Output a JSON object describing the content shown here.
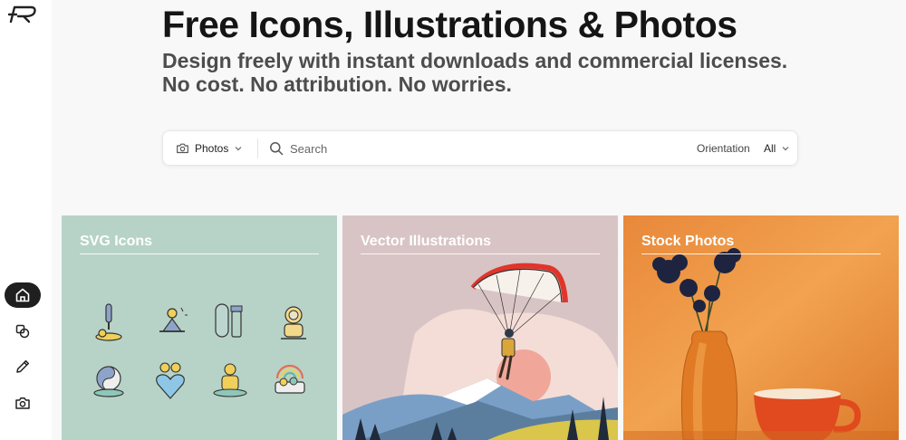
{
  "hero": {
    "title": "Free Icons, Illustrations & Photos",
    "subtitle_line1": "Design freely with instant downloads and commercial licenses.",
    "subtitle_line2": "No cost. No attribution. No worries."
  },
  "search": {
    "type_value": "Photos",
    "placeholder": "Search",
    "orientation_label": "Orientation",
    "orientation_value": "All"
  },
  "sidebar": {
    "items": [
      {
        "name": "home",
        "icon": "home-icon",
        "active": true
      },
      {
        "name": "shapes",
        "icon": "shapes-icon",
        "active": false
      },
      {
        "name": "pencil",
        "icon": "pencil-icon",
        "active": false
      },
      {
        "name": "camera",
        "icon": "camera-icon",
        "active": false
      }
    ]
  },
  "cards": [
    {
      "title": "SVG Icons",
      "bg": "#b7d3c7"
    },
    {
      "title": "Vector Illustrations",
      "bg": "#d9c4c5"
    },
    {
      "title": "Stock Photos",
      "bg": "#ec9a44"
    }
  ],
  "colors": {
    "page_bg": "#f8f8f8",
    "sidebar_active": "#1f1f1f",
    "title": "#151515",
    "subtitle": "#4d4d4d"
  }
}
